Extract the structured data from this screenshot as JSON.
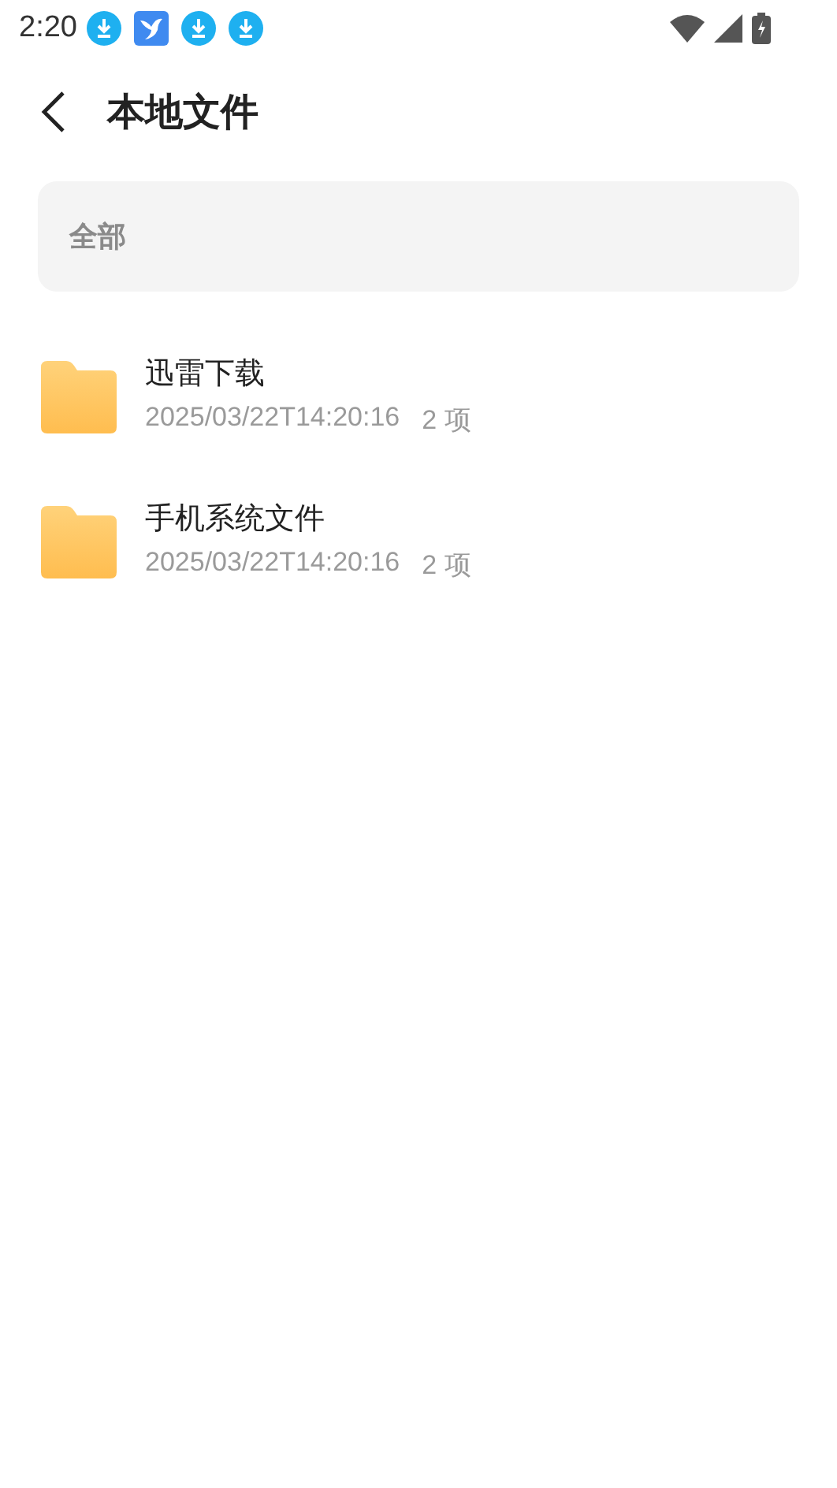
{
  "status_bar": {
    "time": "2:20",
    "notifications": [
      {
        "kind": "download"
      },
      {
        "kind": "bird"
      },
      {
        "kind": "download"
      },
      {
        "kind": "download"
      }
    ]
  },
  "header": {
    "title": "本地文件"
  },
  "filter": {
    "label": "全部"
  },
  "folders": [
    {
      "name": "迅雷下载",
      "date": "2025/03/22T14:20:16",
      "count": "2 项"
    },
    {
      "name": "手机系统文件",
      "date": "2025/03/22T14:20:16",
      "count": "2 项"
    }
  ]
}
